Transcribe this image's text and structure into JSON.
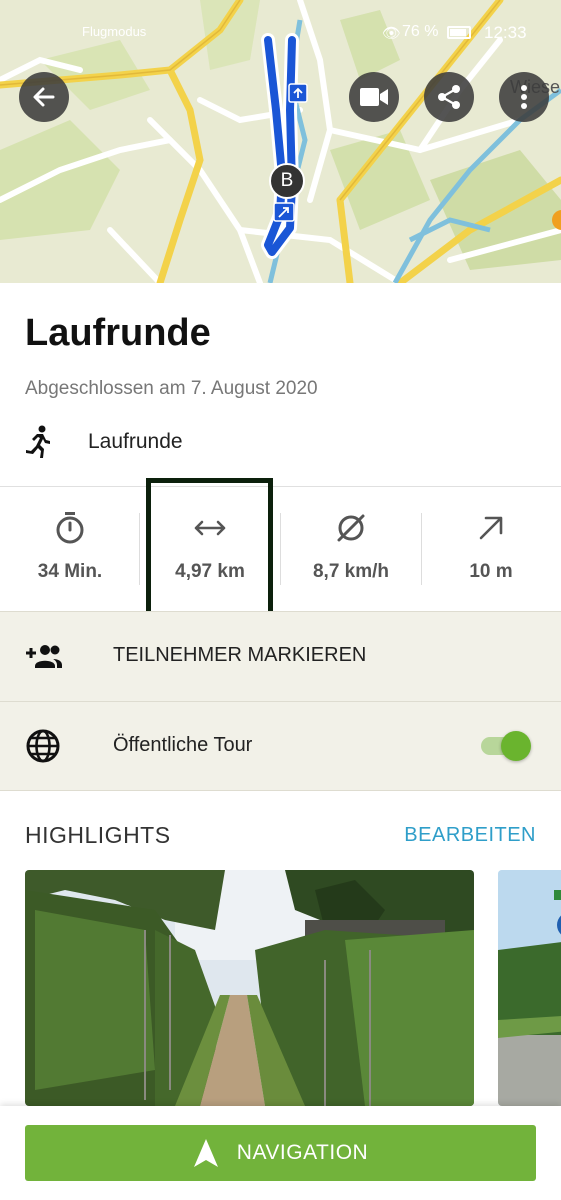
{
  "status_bar": {
    "carrier": "Flugmodus",
    "battery": "76 %",
    "time": "12:33"
  },
  "map": {
    "marker_label": "B",
    "place_label": "Wiese"
  },
  "tour": {
    "title": "Laufrunde",
    "completed": "Abgeschlossen am 7. August 2020",
    "activity_label": "Laufrunde"
  },
  "stats": {
    "duration": "34 Min.",
    "distance": "4,97 km",
    "avg_speed": "8,7 km/h",
    "elevation": "10 m"
  },
  "actions": {
    "tag_participants": "TEILNEHMER MARKIEREN",
    "public_tour": "Öffentliche Tour",
    "public_tour_enabled": true
  },
  "highlights": {
    "title": "HIGHLIGHTS",
    "edit": "BEARBEITEN"
  },
  "bottom": {
    "navigation": "NAVIGATION"
  },
  "colors": {
    "accent_green": "#72b33b",
    "link_blue": "#2f9ec9",
    "route_blue": "#1a56d6"
  }
}
